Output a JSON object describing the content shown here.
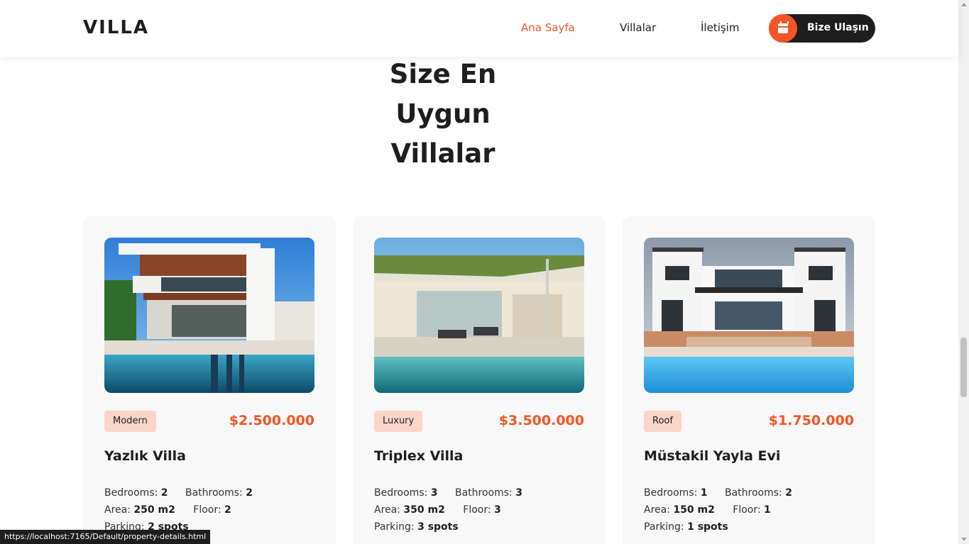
{
  "header": {
    "logo": "VILLA",
    "nav": [
      "Ana Sayfa",
      "Villalar",
      "İletişim"
    ],
    "cta_label": "Bize Ulaşın",
    "cta_icon": "calendar-icon"
  },
  "section": {
    "title_lines": [
      "Size En",
      "Uygun",
      "Villalar"
    ]
  },
  "labels": {
    "bedrooms": "Bedrooms:",
    "bathrooms": "Bathrooms:",
    "area": "Area:",
    "floor": "Floor:",
    "parking": "Parking:"
  },
  "properties": [
    {
      "tag": "Modern",
      "price": "$2.500.000",
      "name": "Yazlık Villa",
      "bedrooms": "2",
      "bathrooms": "2",
      "area": "250 m2",
      "floor": "2",
      "parking": "2 spots"
    },
    {
      "tag": "Luxury",
      "price": "$3.500.000",
      "name": "Triplex Villa",
      "bedrooms": "3",
      "bathrooms": "3",
      "area": "350 m2",
      "floor": "3",
      "parking": "3 spots"
    },
    {
      "tag": "Roof",
      "price": "$1.750.000",
      "name": "Müstakil Yayla Evi",
      "bedrooms": "1",
      "bathrooms": "2",
      "area": "150 m2",
      "floor": "1",
      "parking": "1 spots"
    }
  ],
  "status_bar": {
    "url": "https://localhost:7165/Default/property-details.html"
  },
  "colors": {
    "accent": "#f35525",
    "dark": "#1e1e1e",
    "tag_bg": "#fbd5c8",
    "card_bg": "#f8f8f8"
  }
}
